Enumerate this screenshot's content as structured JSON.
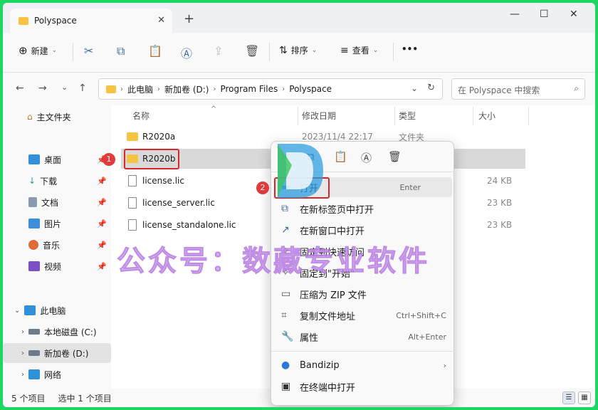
{
  "window": {
    "tab_title": "Polyspace",
    "tab_close": "✕",
    "new_tab": "+",
    "min": "—",
    "max": "☐",
    "close": "✕"
  },
  "toolbar": {
    "new_label": "新建",
    "sort_label": "排序",
    "view_label": "查看",
    "more": "•••"
  },
  "nav": {
    "back": "←",
    "forward": "→",
    "recent": "⌄",
    "up": "↑"
  },
  "address": {
    "crumbs": [
      "此电脑",
      "新加卷 (D:)",
      "Program Files",
      "Polyspace"
    ],
    "chev": "›"
  },
  "search": {
    "placeholder": "在 Polyspace 中搜索"
  },
  "sidebar": {
    "home": "主文件夹",
    "quick": [
      "桌面",
      "下载",
      "文档",
      "图片",
      "音乐",
      "视频"
    ],
    "pc": "此电脑",
    "drives": [
      "本地磁盘 (C:)",
      "新加卷 (D:)"
    ],
    "network": "网络"
  },
  "columns": {
    "name": "名称",
    "date": "修改日期",
    "type": "类型",
    "size": "大小"
  },
  "files": [
    {
      "name": "R2020a",
      "date": "2023/11/4 22:17",
      "type": "文件夹",
      "size": "",
      "kind": "folder"
    },
    {
      "name": "R2020b",
      "date": "",
      "type": "",
      "size": "",
      "kind": "folder"
    },
    {
      "name": "license.lic",
      "date": "",
      "type": "",
      "size": "24 KB",
      "kind": "file"
    },
    {
      "name": "license_server.lic",
      "date": "",
      "type": "",
      "size": "23 KB",
      "kind": "file"
    },
    {
      "name": "license_standalone.lic",
      "date": "",
      "type": "",
      "size": "23 KB",
      "kind": "file"
    }
  ],
  "badges": {
    "one": "1",
    "two": "2"
  },
  "menu": {
    "items": [
      {
        "label": "打开",
        "shortcut": "Enter"
      },
      {
        "label": "在新标签页中打开",
        "shortcut": ""
      },
      {
        "label": "在新窗口中打开",
        "shortcut": ""
      },
      {
        "label": "固定到快速访问",
        "shortcut": ""
      },
      {
        "label": "固定到\"开始\"",
        "shortcut": ""
      },
      {
        "label": "压缩为 ZIP 文件",
        "shortcut": ""
      },
      {
        "label": "复制文件地址",
        "shortcut": "Ctrl+Shift+C"
      },
      {
        "label": "属性",
        "shortcut": "Alt+Enter"
      },
      {
        "label": "Bandizip",
        "shortcut": "›"
      },
      {
        "label": "在终端中打开",
        "shortcut": ""
      }
    ]
  },
  "status": {
    "count": "5 个项目",
    "selected": "选中 1 个项目"
  },
  "watermark": "公众号：数藏专业软件",
  "colors": {
    "accent": "#3c6ea8",
    "highlight": "#d9262a",
    "folder": "#f6c343"
  }
}
